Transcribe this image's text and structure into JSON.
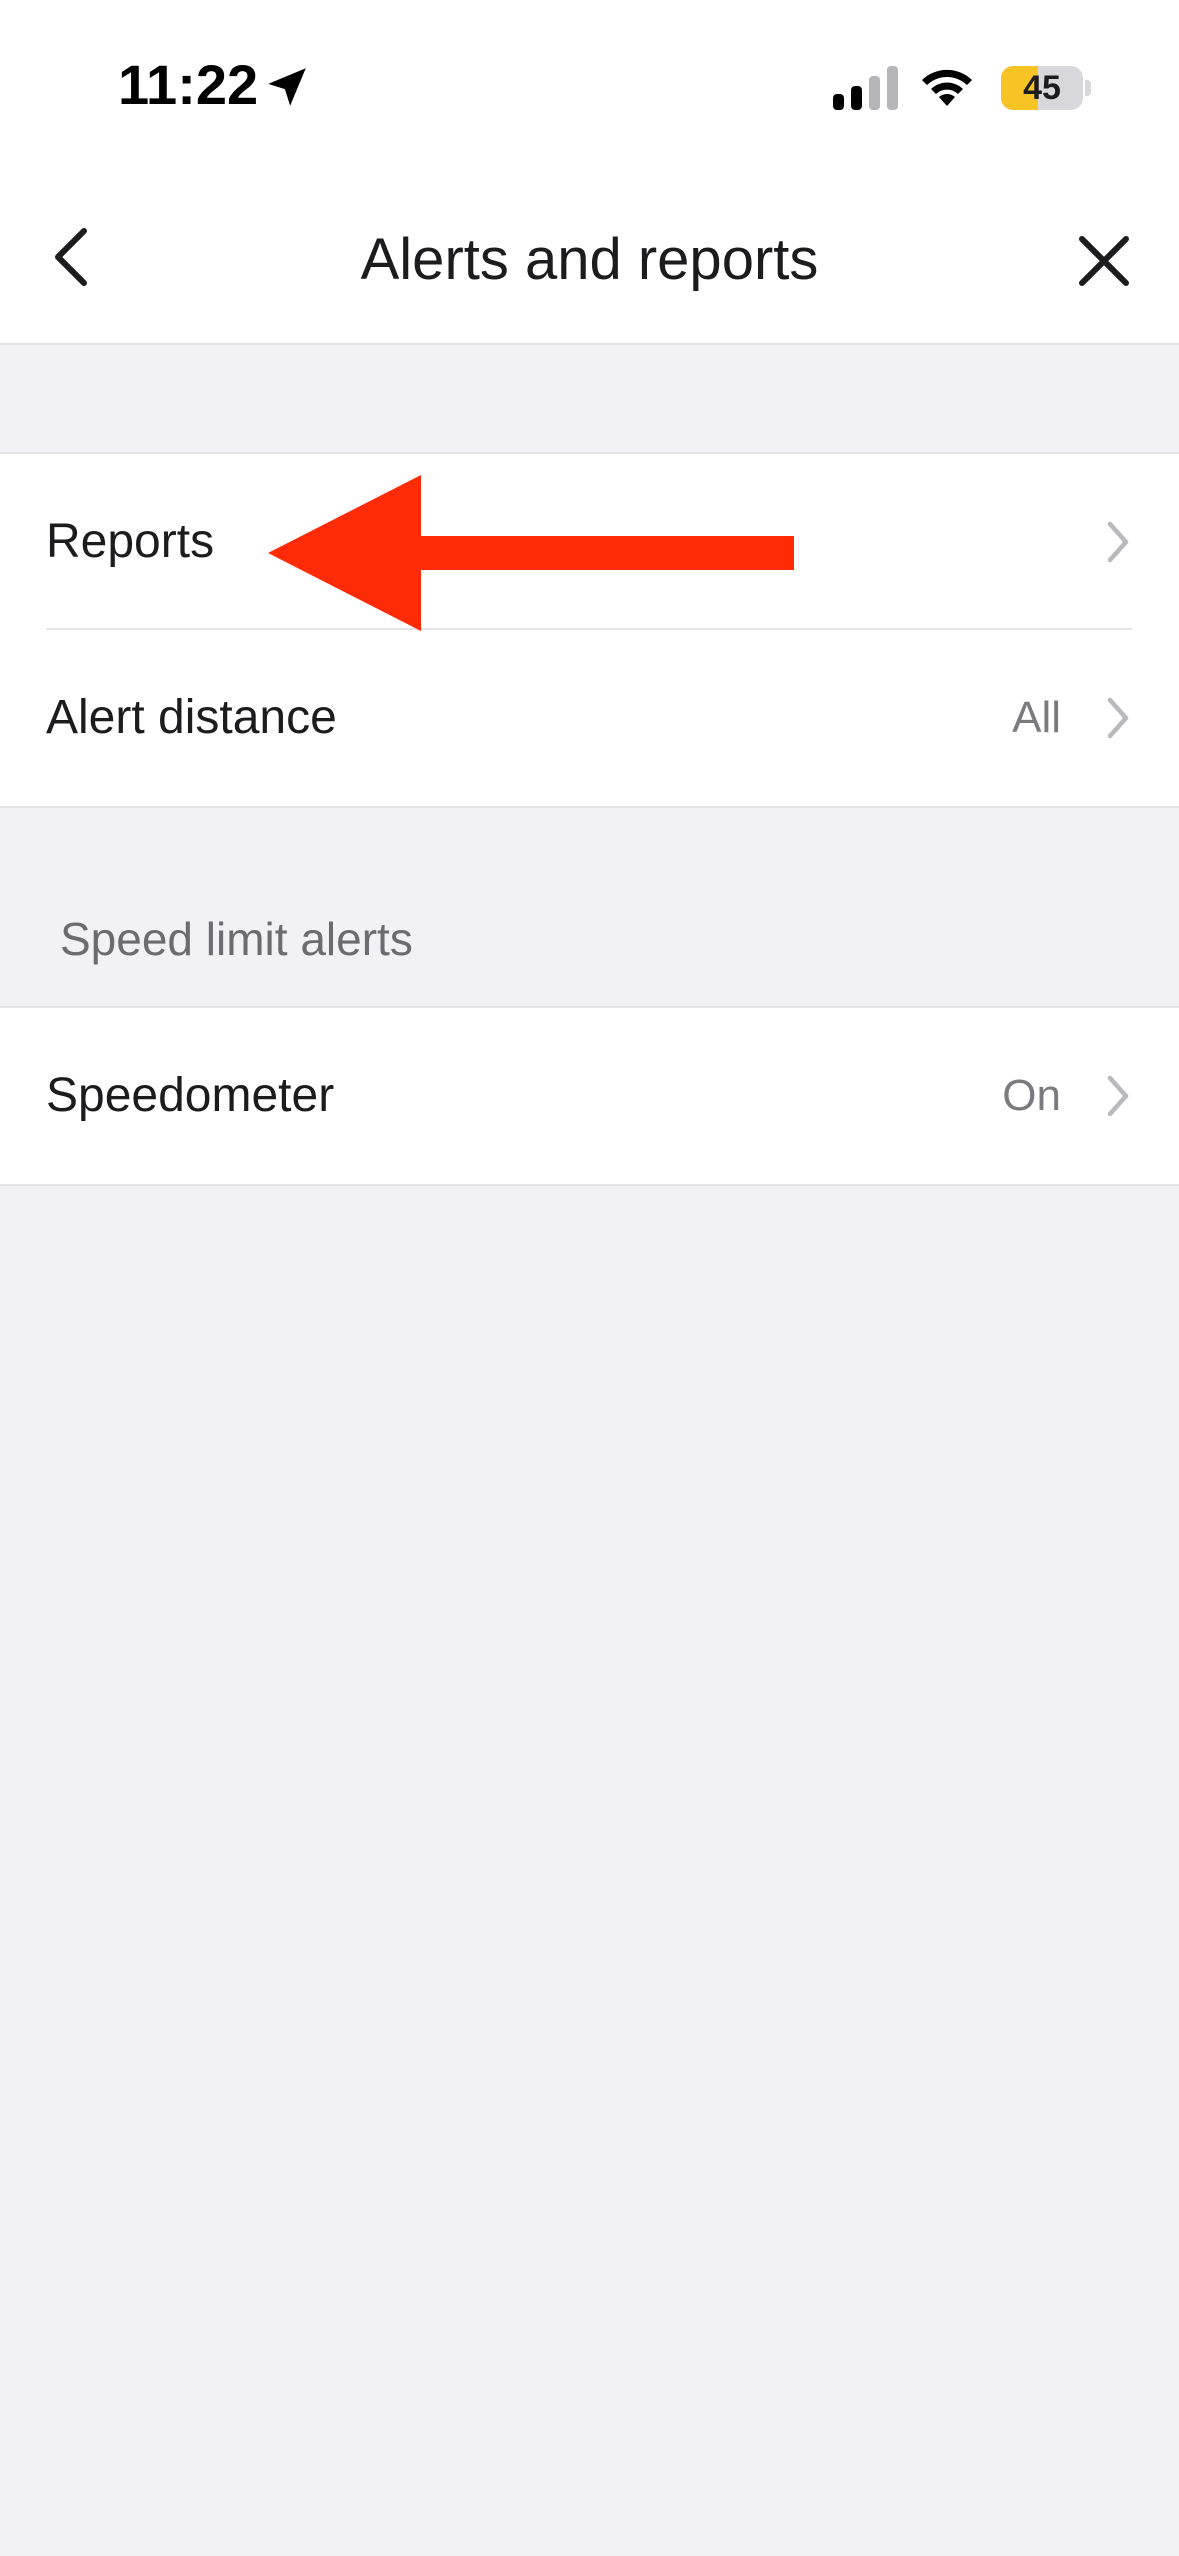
{
  "status_bar": {
    "time": "11:22",
    "battery_level": "45",
    "battery_fraction": 0.45,
    "battery_color": "#f7c325",
    "icons": [
      "location-arrow-icon",
      "cellular-signal-icon",
      "wifi-icon",
      "battery-icon"
    ]
  },
  "nav": {
    "title": "Alerts and reports",
    "back_icon": "chevron-left-icon",
    "close_icon": "close-icon"
  },
  "groups": [
    {
      "rows": [
        {
          "label": "Reports",
          "value": ""
        },
        {
          "label": "Alert distance",
          "value": "All"
        }
      ]
    },
    {
      "header": "Speed limit alerts",
      "rows": [
        {
          "label": "Speedometer",
          "value": "On"
        }
      ]
    }
  ],
  "annotation": {
    "color": "#ff2a06",
    "icon": "red-arrow-pointing-left"
  }
}
